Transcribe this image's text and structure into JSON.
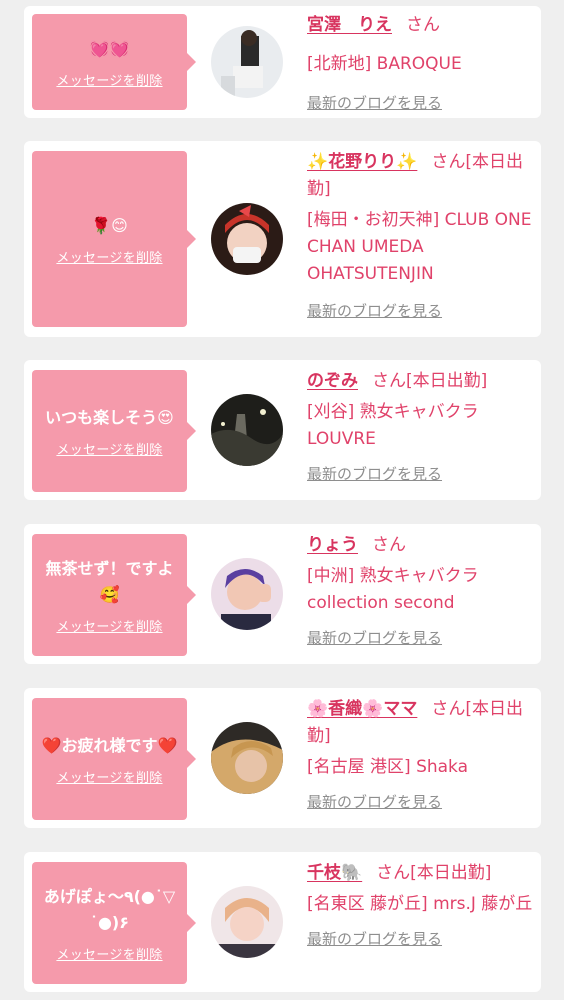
{
  "items": [
    {
      "message": "💓💓",
      "delete_label": "メッセージを削除",
      "name": "宮澤　りえ",
      "suffix": "さん",
      "shop": "[北新地] BAROQUE",
      "blog_label": "最新のブログを見る"
    },
    {
      "message": "🌹😊",
      "delete_label": "メッセージを削除",
      "name": "✨花野りり✨",
      "suffix": "さん[本日出勤]",
      "shop": "[梅田・お初天神] CLUB ONE CHAN UMEDA OHATSUTENJIN",
      "blog_label": "最新のブログを見る"
    },
    {
      "message": "いつも楽しそう😍",
      "delete_label": "メッセージを削除",
      "name": "のぞみ",
      "suffix": "さん[本日出勤]",
      "shop": "[刈谷] 熟女キャバクラ LOUVRE",
      "blog_label": "最新のブログを見る"
    },
    {
      "message": "無茶せず！ですよ🥰",
      "delete_label": "メッセージを削除",
      "name": "りょう",
      "suffix": "さん",
      "shop": "[中洲] 熟女キャバクラ collection second",
      "blog_label": "最新のブログを見る"
    },
    {
      "message": "❤️お疲れ様です❤️",
      "delete_label": "メッセージを削除",
      "name": "🌸香織🌸ママ",
      "suffix": "さん[本日出勤]",
      "shop": "[名古屋 港区] Shaka",
      "blog_label": "最新のブログを見る"
    },
    {
      "message": "あげぽょ〜٩(●˙▽˙●)۶",
      "delete_label": "メッセージを削除",
      "name": "千枝🐘",
      "suffix": "さん[本日出勤]",
      "shop": "[名東区 藤が丘] mrs.J 藤が丘",
      "blog_label": "最新のブログを見る"
    }
  ],
  "colors": {
    "bubble": "#f59aab",
    "name": "#d8345f",
    "link_gray": "#8e8e8e",
    "background": "#efefef"
  }
}
